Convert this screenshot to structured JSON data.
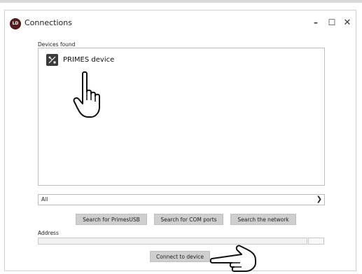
{
  "window": {
    "title": "Connections",
    "icon_label": "LD"
  },
  "titlebar_controls": {
    "minimize": "–",
    "maximize": "☐",
    "close": "✕"
  },
  "devices": {
    "label": "Devices found",
    "items": [
      {
        "label": "PRIMES device"
      }
    ]
  },
  "filter": {
    "selected": "All"
  },
  "search_buttons": [
    {
      "label": "Search for PrimesUSB"
    },
    {
      "label": "Search for COM ports"
    },
    {
      "label": "Search the network"
    }
  ],
  "address": {
    "label": "Address",
    "value": ""
  },
  "connect_button": {
    "label": "Connect to device"
  }
}
